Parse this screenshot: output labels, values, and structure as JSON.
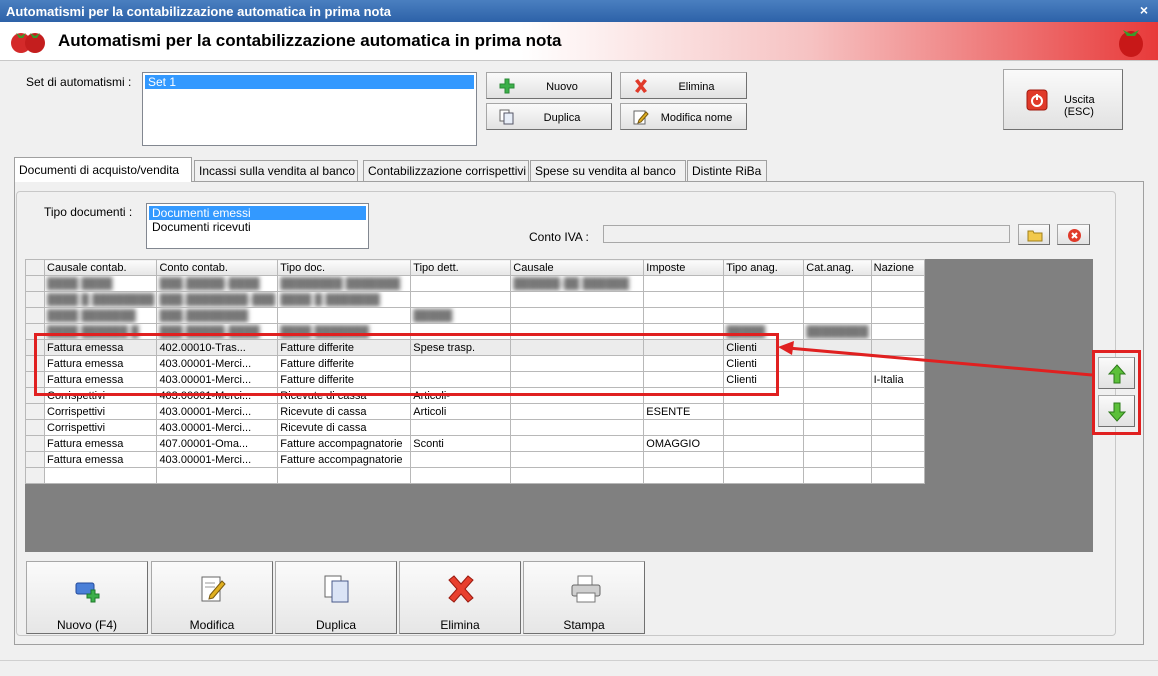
{
  "window": {
    "title": "Automatismi per la contabilizzazione automatica in prima nota",
    "close_glyph": "×"
  },
  "header": {
    "title": "Automatismi per la contabilizzazione automatica in prima nota"
  },
  "set": {
    "label": "Set di automatismi :",
    "items": [
      "Set 1"
    ],
    "buttons": {
      "nuovo": "Nuovo",
      "elimina": "Elimina",
      "duplica": "Duplica",
      "modifica_nome": "Modifica nome"
    }
  },
  "uscita": "Uscita (ESC)",
  "tabs": [
    "Documenti di acquisto/vendita",
    "Incassi sulla vendita al banco",
    "Contabilizzazione corrispettivi",
    "Spese su vendita al banco",
    "Distinte RiBa"
  ],
  "tipo_documenti": {
    "label": "Tipo documenti :",
    "items": [
      "Documenti emessi",
      "Documenti ricevuti"
    ]
  },
  "conto_iva": {
    "label": "Conto IVA :",
    "value": ""
  },
  "grid": {
    "columns": [
      "Causale contab.",
      "Conto contab.",
      "Tipo doc.",
      "Tipo dett.",
      "Causale",
      "Imposte",
      "Tipo anag.",
      "Cat.anag.",
      "Nazione"
    ],
    "rows": [
      [
        "Fattura emessa",
        "402.00010-Tras...",
        "Fatture differite",
        "Spese trasp.",
        "",
        "",
        "Clienti",
        "",
        ""
      ],
      [
        "Fattura emessa",
        "403.00001-Merci...",
        "Fatture differite",
        "",
        "",
        "",
        "Clienti",
        "",
        ""
      ],
      [
        "Fattura emessa",
        "403.00001-Merci...",
        "Fatture differite",
        "",
        "",
        "",
        "Clienti",
        "",
        "I-Italia"
      ],
      [
        "Corrispettivi",
        "403.00001-Merci...",
        "Ricevute di cassa",
        "Articoli-",
        "",
        "",
        "",
        "",
        ""
      ],
      [
        "Corrispettivi",
        "403.00001-Merci...",
        "Ricevute di cassa",
        "Articoli",
        "",
        "ESENTE",
        "",
        "",
        ""
      ],
      [
        "Corrispettivi",
        "403.00001-Merci...",
        "Ricevute di cassa",
        "",
        "",
        "",
        "",
        "",
        ""
      ],
      [
        "Fattura emessa",
        "407.00001-Oma...",
        "Fatture accompagnatorie",
        "Sconti",
        "",
        "OMAGGIO",
        "",
        "",
        ""
      ],
      [
        "Fattura emessa",
        "403.00001-Merci...",
        "Fatture accompagnatorie",
        "",
        "",
        "",
        "",
        "",
        ""
      ]
    ]
  },
  "bottom_buttons": {
    "nuovo": "Nuovo (F4)",
    "modifica": "Modifica",
    "duplica": "Duplica",
    "elimina": "Elimina",
    "stampa": "Stampa"
  },
  "colors": {
    "accent_red": "#e02020",
    "selection": "#3399ff",
    "title_blue": "#2d62a8"
  }
}
